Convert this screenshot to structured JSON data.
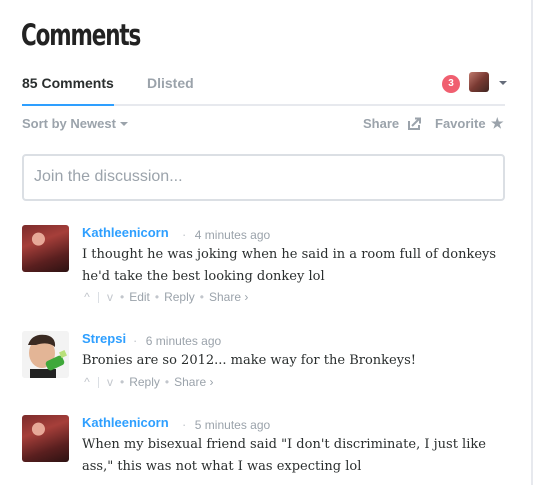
{
  "page": {
    "title": "Comments"
  },
  "tabs": {
    "comments": "85 Comments",
    "dlisted": "Dlisted"
  },
  "notifications": {
    "count": "3"
  },
  "toolbar": {
    "sort_label": "Sort by Newest",
    "share_label": "Share",
    "favorite_label": "Favorite"
  },
  "composer": {
    "placeholder": "Join the discussion..."
  },
  "comments": [
    {
      "author": "Kathleenicorn",
      "time": "4 minutes ago",
      "text": "I thought he was joking when he said in a room full of donkeys he'd take the best looking donkey lol",
      "actions": {
        "edit": "Edit",
        "reply": "Reply",
        "share": "Share ›"
      }
    },
    {
      "author": "Strepsi",
      "time": "6 minutes ago",
      "text": "Bronies are so 2012... make way for the Bronkeys!",
      "actions": {
        "reply": "Reply",
        "share": "Share ›"
      }
    },
    {
      "author": "Kathleenicorn",
      "time": "5 minutes ago",
      "text": "When my bisexual friend said \"I don't discriminate, I just like ass,\" this was not what I was expecting lol",
      "actions": {}
    }
  ],
  "icons": {
    "vote_up": "^",
    "vote_down": "v",
    "share_icon": "share-box-arrow",
    "favorite_icon": "star"
  },
  "colors": {
    "accent_blue": "#2e9fff",
    "notification_red": "#f05f70",
    "muted_text": "#9ba3ab",
    "border": "#dbdfe4"
  }
}
